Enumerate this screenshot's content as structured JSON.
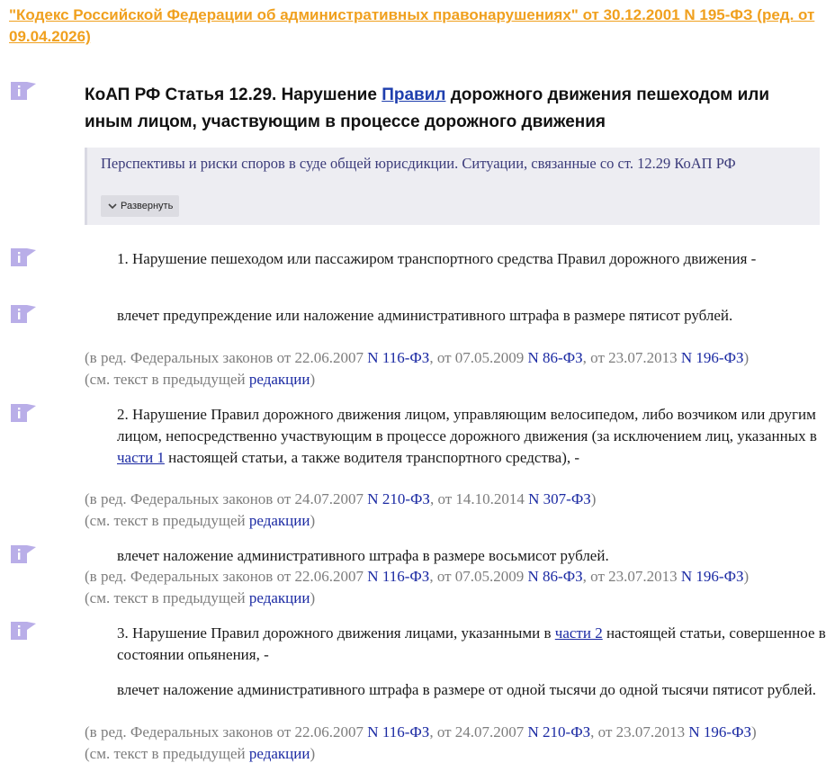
{
  "doc_link": "\"Кодекс Российской Федерации об административных правонарушениях\" от 30.12.2001 N 195-ФЗ (ред. от 09.04.2026)",
  "title": {
    "prefix": "КоАП РФ Статья 12.29. Нарушение ",
    "link": "Правил",
    "suffix": " дорожного движения пешеходом или иным лицом, участвующим в процессе дорожного движения"
  },
  "note": {
    "text": "Перспективы и риски споров в суде общей юрисдикции. Ситуации, связанные со ст. 12.29 КоАП РФ",
    "expand_label": "Развернуть"
  },
  "colors": {
    "link_orange": "#f0a01e",
    "icon_purple": "#b9aee8",
    "link_blue": "#1b2aa3"
  },
  "paragraphs": {
    "p1": "1. Нарушение пешеходом или пассажиром транспортного средства Правил дорожного движения -",
    "p1_penalty": "влечет предупреждение или наложение административного штрафа в размере пятисот рублей.",
    "p2_a": "2. Нарушение Правил дорожного движения лицом, управляющим велосипедом, либо возчиком или другим лицом, непосредственно участвующим в процессе дорожного движения (за исключением лиц, указанных в ",
    "p2_link": "части 1",
    "p2_b": " настоящей статьи, а также водителя транспортного средства), -",
    "p2_penalty": "влечет наложение административного штрафа в размере восьмисот рублей.",
    "p3_a": "3. Нарушение Правил дорожного движения лицами, указанными в ",
    "p3_link": "части 2",
    "p3_b": " настоящей статьи, совершенное в состоянии опьянения, -",
    "p3_penalty": "влечет наложение административного штрафа в размере от одной тысячи до одной тысячи пятисот рублей."
  },
  "meta": {
    "m1": {
      "t1": "(в ред. Федеральных законов от 22.06.2007 ",
      "l1": "N 116-ФЗ",
      "t2": ", от 07.05.2009 ",
      "l2": "N 86-ФЗ",
      "t3": ", от 23.07.2013 ",
      "l3": "N 196-ФЗ",
      "t4": ")"
    },
    "m2": {
      "t1": "(в ред. Федеральных законов от 24.07.2007 ",
      "l1": "N 210-ФЗ",
      "t2": ", от 14.10.2014 ",
      "l2": "N 307-ФЗ",
      "t3": ")"
    },
    "m3": {
      "t1": "(в ред. Федеральных законов от 22.06.2007 ",
      "l1": "N 116-ФЗ",
      "t2": ", от 07.05.2009 ",
      "l2": "N 86-ФЗ",
      "t3": ", от 23.07.2013 ",
      "l3": "N 196-ФЗ",
      "t4": ")"
    },
    "m4": {
      "t1": "(в ред. Федеральных законов от 22.06.2007 ",
      "l1": "N 116-ФЗ",
      "t2": ", от 24.07.2007 ",
      "l2": "N 210-ФЗ",
      "t3": ", от 23.07.2013 ",
      "l3": "N 196-ФЗ",
      "t4": ")"
    },
    "prev": {
      "t1": "(см. текст в предыдущей ",
      "link": "редакции",
      "t2": ")"
    }
  }
}
